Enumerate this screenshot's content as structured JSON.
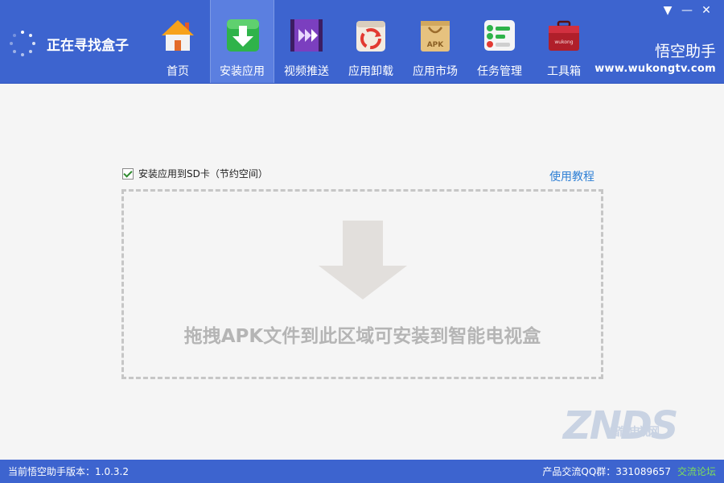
{
  "status": {
    "text": "正在寻找盒子"
  },
  "nav": [
    {
      "label": "首页",
      "icon": "home-icon"
    },
    {
      "label": "安装应用",
      "icon": "install-download-icon"
    },
    {
      "label": "视频推送",
      "icon": "video-push-icon"
    },
    {
      "label": "应用卸载",
      "icon": "uninstall-icon"
    },
    {
      "label": "应用市场",
      "icon": "app-market-apk-bag-icon"
    },
    {
      "label": "任务管理",
      "icon": "task-manager-icon"
    },
    {
      "label": "工具箱",
      "icon": "toolbox-icon"
    }
  ],
  "active_tab": "安装应用",
  "window_controls": {
    "menu": "▼",
    "minimize": "—",
    "close": "✕"
  },
  "brand": {
    "name": "悟空助手",
    "url": "www.wukongtv.com"
  },
  "install": {
    "sd_option_label": "安装应用到SD卡（节约空间）",
    "sd_option_checked": true,
    "tutorial_link": "使用教程",
    "drop_text": "拖拽APK文件到此区域可安装到智能电视盒"
  },
  "icon_text": {
    "apk": "APK",
    "toolbox": "wukong"
  },
  "watermark": {
    "text": "ZNDS",
    "subtitle": "智能电视网"
  },
  "footer": {
    "version": "当前悟空助手版本：1.0.3.2",
    "qq_group": "产品交流QQ群：331089657",
    "forum_link": "交流论坛"
  },
  "colors": {
    "header": "#3d64cf",
    "active_tab": "#5b7fe0",
    "link": "#2d7fd5",
    "forum": "#7dde5a"
  }
}
